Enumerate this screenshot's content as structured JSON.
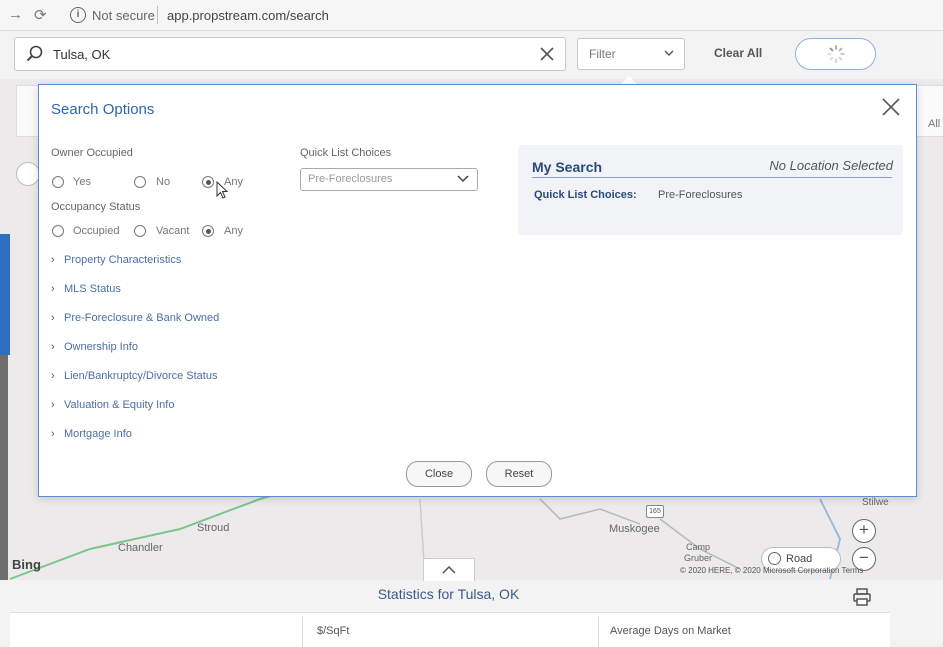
{
  "browser": {
    "security": "Not secure",
    "url": "app.propstream.com/search"
  },
  "header": {
    "search_value": "Tulsa, OK",
    "filter_label": "Filter",
    "clear_all": "Clear All"
  },
  "map": {
    "all_label": "All",
    "towns": [
      "Stroud",
      "Chandler",
      "Muskogee",
      "Camp",
      "Gruber",
      "Stilwe"
    ],
    "highway": "165",
    "bing": "Bing",
    "road_label": "Road",
    "zoom_in": "+",
    "zoom_out": "−",
    "copyright": "© 2020 HERE, © 2020 Microsoft Corporation  Terms"
  },
  "stats": {
    "title": "Statistics for Tulsa, OK",
    "columns": [
      "$/SqFt",
      "Average Days on Market"
    ]
  },
  "modal": {
    "title": "Search Options",
    "owner_occupied": {
      "label": "Owner Occupied",
      "options": [
        "Yes",
        "No",
        "Any"
      ],
      "selected": "Any"
    },
    "occupancy_status": {
      "label": "Occupancy Status",
      "options": [
        "Occupied",
        "Vacant",
        "Any"
      ],
      "selected": "Any"
    },
    "sections": [
      "Property Characteristics",
      "MLS Status",
      "Pre-Foreclosure & Bank Owned",
      "Ownership Info",
      "Lien/Bankruptcy/Divorce Status",
      "Valuation & Equity Info",
      "Mortgage Info"
    ],
    "quick_list": {
      "label": "Quick List Choices",
      "selected": "Pre-Foreclosures"
    },
    "my_search": {
      "title": "My Search",
      "location": "No Location Selected",
      "key": "Quick List Choices:",
      "value": "Pre-Foreclosures"
    },
    "close_label": "Close",
    "reset_label": "Reset"
  }
}
